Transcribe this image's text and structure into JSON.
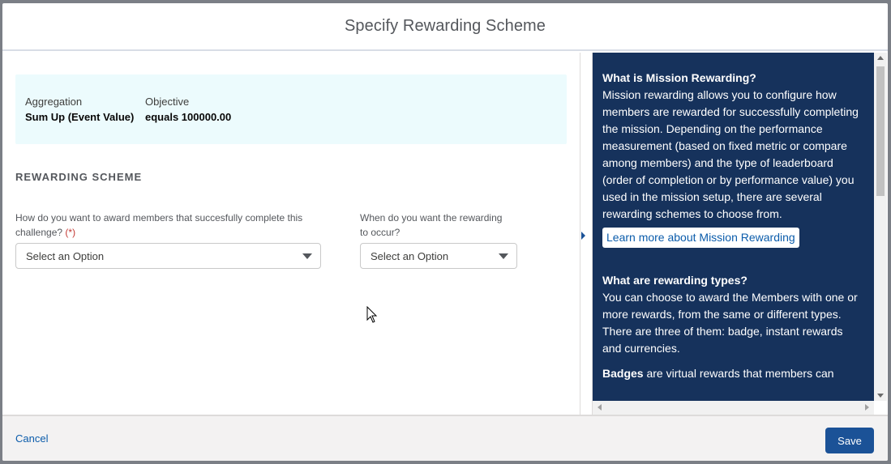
{
  "modal": {
    "title": "Specify Rewarding Scheme"
  },
  "summary": {
    "aggregation_label": "Aggregation",
    "aggregation_value": "Sum Up (Event Value)",
    "objective_label": "Objective",
    "objective_value": "equals 100000.00"
  },
  "section": {
    "title": "REWARDING SCHEME"
  },
  "fields": {
    "award": {
      "label": "How do you want to award members that succesfully complete this challenge?",
      "required_marker": "(*)",
      "placeholder": "Select an Option"
    },
    "timing": {
      "label_line1": "When do you want the rewarding",
      "label_line2": "to occur?",
      "placeholder": "Select an Option"
    }
  },
  "help": {
    "q1": "What is Mission Rewarding?",
    "a1": "Mission rewarding allows you to configure how members are rewarded for successfully completing the mission. Depending on the performance measurement (based on fixed metric or compare among members) and the type of leaderboard (order of completion or by performance value) you used in the mission setup, there are several rewarding schemes to choose from.",
    "learn_more": "Learn more about Mission Rewarding",
    "q2": "What are rewarding types?",
    "a2": "You can choose to award the Members with one or more rewards, from the same or different types. There are three of them: badge, instant rewards and currencies.",
    "badges_term": "Badges",
    "badges_text": " are virtual rewards that members can"
  },
  "footer": {
    "cancel": "Cancel",
    "save": "Save"
  },
  "colors": {
    "brand": "#1b5297",
    "help_bg": "#16325c",
    "summary_bg": "#ecfbfd",
    "link": "#0b5cab"
  }
}
